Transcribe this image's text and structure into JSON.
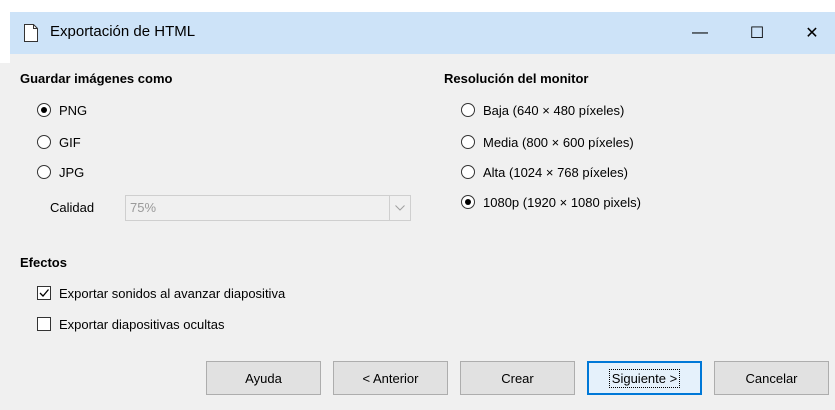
{
  "window": {
    "title": "Exportación de HTML",
    "minimize_glyph": "—",
    "maximize_glyph": "☐",
    "close_glyph": "✕"
  },
  "save_images": {
    "heading": "Guardar imágenes como",
    "options": [
      {
        "label": "PNG",
        "checked": true
      },
      {
        "label": "GIF",
        "checked": false
      },
      {
        "label": "JPG",
        "checked": false
      }
    ],
    "quality_label": "Calidad",
    "quality_value": "75%"
  },
  "monitor_resolution": {
    "heading": "Resolución del monitor",
    "options": [
      {
        "label": "Baja (640 × 480 píxeles)",
        "checked": false
      },
      {
        "label": "Media (800 × 600 píxeles)",
        "checked": false
      },
      {
        "label": "Alta (1024 × 768 píxeles)",
        "checked": false
      },
      {
        "label": "1080p (1920 × 1080 pixels)",
        "checked": true
      }
    ]
  },
  "effects": {
    "heading": "Efectos",
    "options": [
      {
        "label": "Exportar sonidos al avanzar diapositiva",
        "checked": true
      },
      {
        "label": "Exportar diapositivas ocultas",
        "checked": false
      }
    ]
  },
  "buttons": {
    "help": "Ayuda",
    "previous": "< Anterior",
    "create": "Crear",
    "next": "Siguiente >",
    "cancel": "Cancelar"
  },
  "colors": {
    "titlebar": "#cde3f8",
    "default_button_border": "#0078d7"
  }
}
